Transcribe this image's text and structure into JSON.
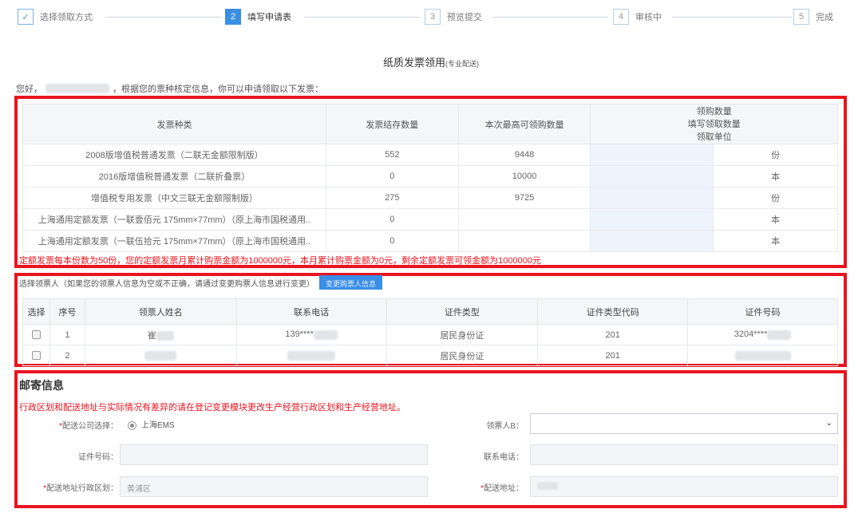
{
  "steps": [
    {
      "num": "✓",
      "label": "选择领取方式"
    },
    {
      "num": "2",
      "label": "填写申请表"
    },
    {
      "num": "3",
      "label": "预览提交"
    },
    {
      "num": "4",
      "label": "审核中"
    },
    {
      "num": "5",
      "label": "完成"
    }
  ],
  "title": {
    "main": "纸质发票领用",
    "sub": "(专业配送)"
  },
  "greeting": {
    "prefix": "您好，",
    "suffix": "，根据您的票种核定信息，你可以申请领取以下发票："
  },
  "invoice_table": {
    "headers": {
      "type": "发票种类",
      "stock": "发票结存数量",
      "max": "本次最高可领购数量",
      "qty_lines": [
        "领购数量",
        "填写领取数量",
        "领取单位"
      ]
    },
    "rows": [
      {
        "type": "2008版增值税普通发票（二联无金额限制版）",
        "stock": "552",
        "max": "9448",
        "unit": "份"
      },
      {
        "type": "2016版增值税普通发票（二联折叠票）",
        "stock": "0",
        "max": "10000",
        "unit": "本"
      },
      {
        "type": "增值税专用发票（中文三联无金额限制版）",
        "stock": "275",
        "max": "9725",
        "unit": "份"
      },
      {
        "type": "上海通用定额发票（一联壹佰元 175mm×77mm）（原上海市国税通用..",
        "stock": "0",
        "max": "",
        "unit": "本"
      },
      {
        "type": "上海通用定额发票（一联伍拾元 175mm×77mm）（原上海市国税通用..",
        "stock": "0",
        "max": "",
        "unit": "本"
      }
    ]
  },
  "quota_note": "定额发票每本份数为50份，您的定额发票月累计购票金额为1000000元，本月累计购票金额为0元，剩余定额发票可领金额为1000000元",
  "person_section": {
    "hint": "选择领票人（如果您的领票人信息为空或不正确，请通过变更购票人信息进行变更）",
    "change_button": "变更购票人信息",
    "headers": [
      "选择",
      "序号",
      "领票人姓名",
      "联系电话",
      "证件类型",
      "证件类型代码",
      "证件号码"
    ],
    "rows": [
      {
        "seq": "1",
        "name": "崔",
        "phone": "139****",
        "id_type": "居民身份证",
        "id_code": "201",
        "id_no": "3204****"
      },
      {
        "seq": "2",
        "name": "",
        "phone": "",
        "id_type": "居民身份证",
        "id_code": "201",
        "id_no": ""
      }
    ]
  },
  "mail": {
    "title": "邮寄信息",
    "note": "行政区划和配送地址与实际情况有差异的请在登记变更模块更改生产经营行政区划和生产经营地址。",
    "courier_label": "配送公司选择：",
    "courier_option": "上海EMS",
    "recipient_label": "领票人B：",
    "id_label": "证件号码：",
    "phone_label": "联系电话：",
    "district_label": "配送地址行政区划：",
    "district_value": "黄浦区",
    "address_label": "配送地址："
  }
}
